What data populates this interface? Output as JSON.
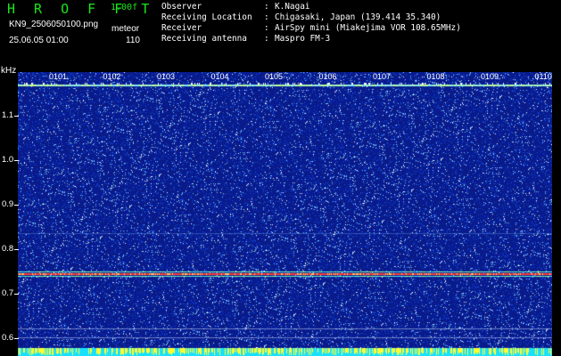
{
  "header": {
    "logo": "HROFFT",
    "version": "1.00f",
    "filename": "KN9_2506050100.png",
    "meteor_label": "meteor",
    "datetime": "25.06.05 01:00",
    "meteor_count": "110"
  },
  "station": [
    {
      "key": "Observer",
      "sep": ":",
      "value": "K.Nagai"
    },
    {
      "key": "Receiving Location",
      "sep": ":",
      "value": "Chigasaki, Japan (139.414 35.340)"
    },
    {
      "key": "Receiver",
      "sep": ":",
      "value": "AirSpy mini (Miakejima VOR 108.65MHz)"
    },
    {
      "key": "Receiving antenna",
      "sep": ":",
      "value": "Maspro FM-3"
    }
  ],
  "axis": {
    "y_unit": "kHz",
    "y_labels": [
      "1.1",
      "1.0",
      "0.9",
      "0.8",
      "0.7",
      "0.6"
    ],
    "time_labels": [
      "0101",
      "0102",
      "0103",
      "0104",
      "0105",
      "0106",
      "0107",
      "0108",
      "0109",
      "0110"
    ]
  },
  "colors": {
    "logo": "#19e619",
    "noise_bg": "#0a1a86",
    "carrier": "#ff3a3a"
  }
}
